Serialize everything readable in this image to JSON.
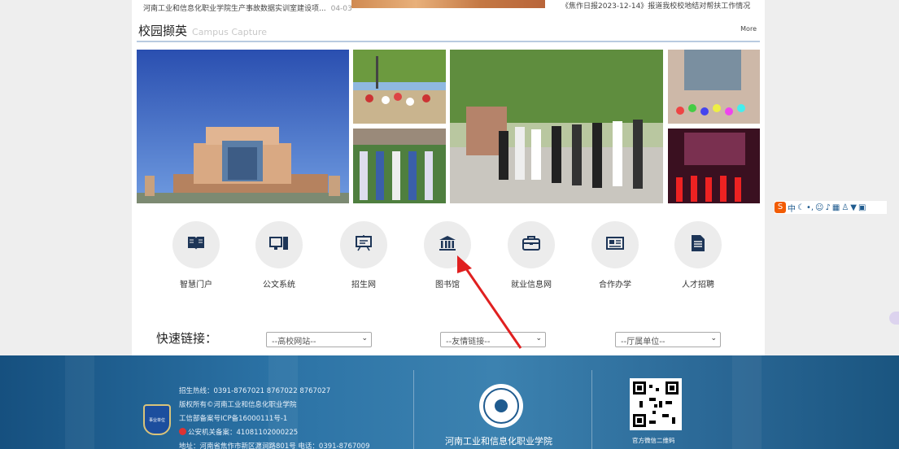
{
  "top_news": {
    "left_title": "河南工业和信息化职业学院生产事故数据实训室建设项...",
    "left_date": "04-03",
    "right_title": "《焦作日报2023-12-14》报道我校校地结对帮扶工作情况"
  },
  "section": {
    "title_cn": "校园撷英",
    "title_en": "Campus Capture",
    "more_label": "More"
  },
  "photos": [
    "main-building-photo",
    "basketball-photo",
    "parade-photo",
    "students-group-photo",
    "stage-performance-photo",
    "dance-performance-photo"
  ],
  "quick_links": [
    {
      "label": "智慧门户",
      "icon": "book-open-icon"
    },
    {
      "label": "公文系统",
      "icon": "computer-icon"
    },
    {
      "label": "招生网",
      "icon": "presentation-board-icon"
    },
    {
      "label": "图书馆",
      "icon": "library-building-icon"
    },
    {
      "label": "就业信息网",
      "icon": "briefcase-icon"
    },
    {
      "label": "合作办学",
      "icon": "newspaper-icon"
    },
    {
      "label": "人才招聘",
      "icon": "document-icon"
    }
  ],
  "quick_nav": {
    "title": "快速链接：",
    "selects": [
      {
        "value": "--高校网站--"
      },
      {
        "value": "--友情链接--"
      },
      {
        "value": "--厅属单位--"
      }
    ]
  },
  "footer": {
    "phone": "招生热线：0391-8767021  8767022  8767027",
    "copyright": "版权所有©河南工业和信息化职业学院",
    "icp": "工信部备案号ICP备16000111号-1",
    "police": "公安机关备案：41081102000225",
    "address": "地址：河南省焦作市新区瀍涧路801号  电话：0391-8767009",
    "college_name": "河南工业和信息化职业学院",
    "qr_caption": "官方微信二维码",
    "badge_label": "事业单位",
    "logo_text": "河南工业和信息化职业学院"
  },
  "ime_toolbar": {
    "lang": "中"
  },
  "colors": {
    "accent": "#1f5b8f",
    "icon": "#1d3557",
    "arrow": "#e02020"
  }
}
